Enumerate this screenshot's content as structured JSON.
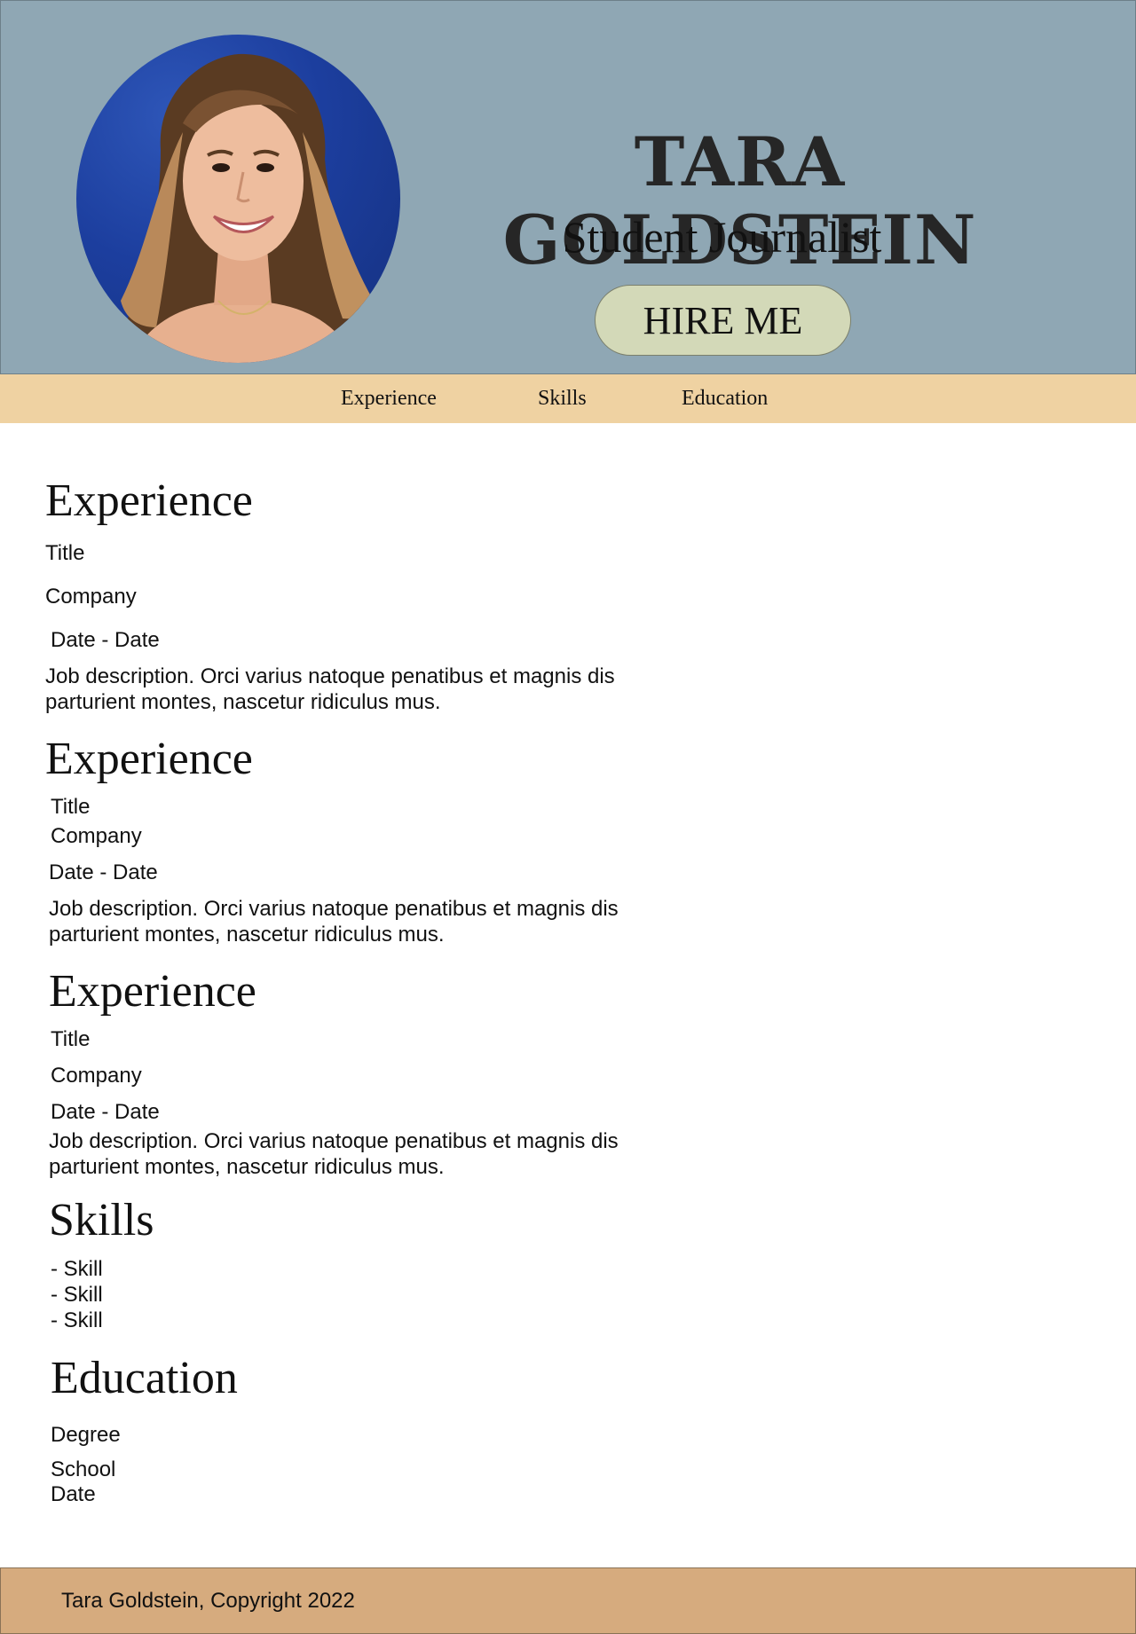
{
  "header": {
    "name": "TARA GOLDSTEIN",
    "role": "Student Journalist",
    "hire_label": "HIRE ME",
    "avatar_icon": "profile-photo"
  },
  "nav": {
    "items": [
      {
        "label": "Experience"
      },
      {
        "label": "Skills"
      },
      {
        "label": "Education"
      }
    ]
  },
  "experience": [
    {
      "heading": "Experience",
      "title": "Title",
      "company": "Company",
      "dates": "Date - Date",
      "description": "Job description. Orci varius natoque penatibus et magnis dis parturient montes, nascetur ridiculus mus."
    },
    {
      "heading": "Experience",
      "title": "Title",
      "company": "Company",
      "dates": "Date - Date",
      "description": "Job description. Orci varius natoque penatibus et magnis dis parturient montes, nascetur ridiculus mus."
    },
    {
      "heading": "Experience",
      "title": "Title",
      "company": "Company",
      "dates": "Date - Date",
      "description": "Job description. Orci varius natoque penatibus et magnis dis parturient montes, nascetur ridiculus mus."
    }
  ],
  "skills": {
    "heading": "Skills",
    "items": [
      "- Skill",
      "- Skill",
      "- Skill"
    ]
  },
  "education": {
    "heading": "Education",
    "degree": "Degree",
    "school": "School",
    "date": "Date"
  },
  "footer": {
    "text": "Tara Goldstein, Copyright 2022"
  },
  "colors": {
    "header_bg": "#8fa7b4",
    "nav_bg": "#efd2a2",
    "button_bg": "#d3d9b8",
    "footer_bg": "#d6ab7e"
  }
}
